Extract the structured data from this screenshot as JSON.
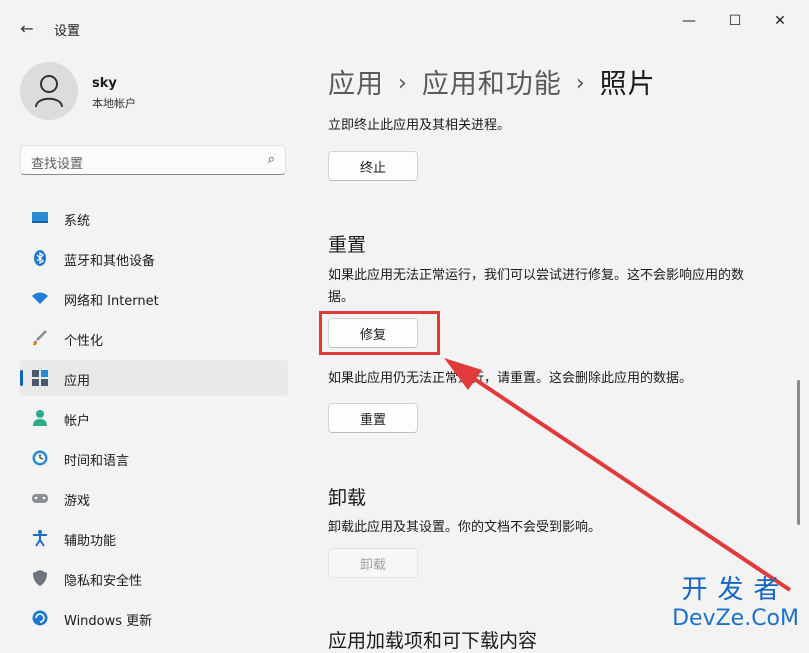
{
  "titlebar": {
    "title": "设置",
    "back": "←",
    "minimize": "—",
    "maximize": "☐",
    "close": "✕"
  },
  "account": {
    "name": "sky",
    "type": "本地帐户"
  },
  "search": {
    "placeholder": "查找设置",
    "icon": "⌕"
  },
  "nav": {
    "items": [
      {
        "label": "系统",
        "icon": "display-icon"
      },
      {
        "label": "蓝牙和其他设备",
        "icon": "bluetooth-icon"
      },
      {
        "label": "网络和 Internet",
        "icon": "wifi-icon"
      },
      {
        "label": "个性化",
        "icon": "brush-icon"
      },
      {
        "label": "应用",
        "icon": "apps-icon",
        "active": true
      },
      {
        "label": "帐户",
        "icon": "person-icon"
      },
      {
        "label": "时间和语言",
        "icon": "clock-globe-icon"
      },
      {
        "label": "游戏",
        "icon": "gamepad-icon"
      },
      {
        "label": "辅助功能",
        "icon": "accessibility-icon"
      },
      {
        "label": "隐私和安全性",
        "icon": "shield-icon"
      },
      {
        "label": "Windows 更新",
        "icon": "update-icon"
      }
    ]
  },
  "breadcrumb": {
    "part1": "应用",
    "sep": "›",
    "part2": "应用和功能",
    "part3": "照片"
  },
  "terminate": {
    "desc": "立即终止此应用及其相关进程。",
    "button": "终止"
  },
  "reset": {
    "heading": "重置",
    "repair_desc_line1": "如果此应用无法正常运行，我们可以尝试进行修复。这不会影响应用的数",
    "repair_desc_line2": "据。",
    "repair_button": "修复",
    "reset_desc": "如果此应用仍无法正常运行，请重置。这会删除此应用的数据。",
    "reset_button": "重置"
  },
  "uninstall": {
    "heading": "卸载",
    "desc": "卸载此应用及其设置。你的文档不会受到影响。",
    "button": "卸载"
  },
  "partial_heading": "应用加载项和可下载内容",
  "watermark": {
    "line1": "开发者",
    "line2": "DevZe.CoM"
  },
  "colors": {
    "accent": "#0067c0",
    "highlight": "#e03a3a",
    "background": "#f3f3f3"
  }
}
